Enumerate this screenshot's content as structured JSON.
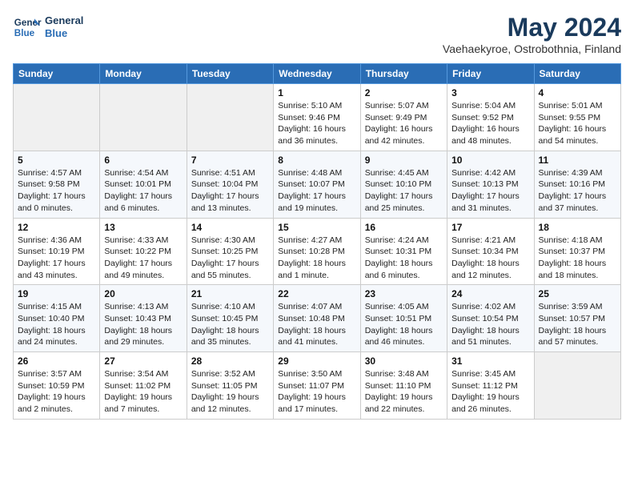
{
  "logo": {
    "line1": "General",
    "line2": "Blue"
  },
  "title": "May 2024",
  "subtitle": "Vaehaekyroe, Ostrobothnia, Finland",
  "headers": [
    "Sunday",
    "Monday",
    "Tuesday",
    "Wednesday",
    "Thursday",
    "Friday",
    "Saturday"
  ],
  "weeks": [
    [
      {
        "day": "",
        "info": ""
      },
      {
        "day": "",
        "info": ""
      },
      {
        "day": "",
        "info": ""
      },
      {
        "day": "1",
        "info": "Sunrise: 5:10 AM\nSunset: 9:46 PM\nDaylight: 16 hours\nand 36 minutes."
      },
      {
        "day": "2",
        "info": "Sunrise: 5:07 AM\nSunset: 9:49 PM\nDaylight: 16 hours\nand 42 minutes."
      },
      {
        "day": "3",
        "info": "Sunrise: 5:04 AM\nSunset: 9:52 PM\nDaylight: 16 hours\nand 48 minutes."
      },
      {
        "day": "4",
        "info": "Sunrise: 5:01 AM\nSunset: 9:55 PM\nDaylight: 16 hours\nand 54 minutes."
      }
    ],
    [
      {
        "day": "5",
        "info": "Sunrise: 4:57 AM\nSunset: 9:58 PM\nDaylight: 17 hours\nand 0 minutes."
      },
      {
        "day": "6",
        "info": "Sunrise: 4:54 AM\nSunset: 10:01 PM\nDaylight: 17 hours\nand 6 minutes."
      },
      {
        "day": "7",
        "info": "Sunrise: 4:51 AM\nSunset: 10:04 PM\nDaylight: 17 hours\nand 13 minutes."
      },
      {
        "day": "8",
        "info": "Sunrise: 4:48 AM\nSunset: 10:07 PM\nDaylight: 17 hours\nand 19 minutes."
      },
      {
        "day": "9",
        "info": "Sunrise: 4:45 AM\nSunset: 10:10 PM\nDaylight: 17 hours\nand 25 minutes."
      },
      {
        "day": "10",
        "info": "Sunrise: 4:42 AM\nSunset: 10:13 PM\nDaylight: 17 hours\nand 31 minutes."
      },
      {
        "day": "11",
        "info": "Sunrise: 4:39 AM\nSunset: 10:16 PM\nDaylight: 17 hours\nand 37 minutes."
      }
    ],
    [
      {
        "day": "12",
        "info": "Sunrise: 4:36 AM\nSunset: 10:19 PM\nDaylight: 17 hours\nand 43 minutes."
      },
      {
        "day": "13",
        "info": "Sunrise: 4:33 AM\nSunset: 10:22 PM\nDaylight: 17 hours\nand 49 minutes."
      },
      {
        "day": "14",
        "info": "Sunrise: 4:30 AM\nSunset: 10:25 PM\nDaylight: 17 hours\nand 55 minutes."
      },
      {
        "day": "15",
        "info": "Sunrise: 4:27 AM\nSunset: 10:28 PM\nDaylight: 18 hours\nand 1 minute."
      },
      {
        "day": "16",
        "info": "Sunrise: 4:24 AM\nSunset: 10:31 PM\nDaylight: 18 hours\nand 6 minutes."
      },
      {
        "day": "17",
        "info": "Sunrise: 4:21 AM\nSunset: 10:34 PM\nDaylight: 18 hours\nand 12 minutes."
      },
      {
        "day": "18",
        "info": "Sunrise: 4:18 AM\nSunset: 10:37 PM\nDaylight: 18 hours\nand 18 minutes."
      }
    ],
    [
      {
        "day": "19",
        "info": "Sunrise: 4:15 AM\nSunset: 10:40 PM\nDaylight: 18 hours\nand 24 minutes."
      },
      {
        "day": "20",
        "info": "Sunrise: 4:13 AM\nSunset: 10:43 PM\nDaylight: 18 hours\nand 29 minutes."
      },
      {
        "day": "21",
        "info": "Sunrise: 4:10 AM\nSunset: 10:45 PM\nDaylight: 18 hours\nand 35 minutes."
      },
      {
        "day": "22",
        "info": "Sunrise: 4:07 AM\nSunset: 10:48 PM\nDaylight: 18 hours\nand 41 minutes."
      },
      {
        "day": "23",
        "info": "Sunrise: 4:05 AM\nSunset: 10:51 PM\nDaylight: 18 hours\nand 46 minutes."
      },
      {
        "day": "24",
        "info": "Sunrise: 4:02 AM\nSunset: 10:54 PM\nDaylight: 18 hours\nand 51 minutes."
      },
      {
        "day": "25",
        "info": "Sunrise: 3:59 AM\nSunset: 10:57 PM\nDaylight: 18 hours\nand 57 minutes."
      }
    ],
    [
      {
        "day": "26",
        "info": "Sunrise: 3:57 AM\nSunset: 10:59 PM\nDaylight: 19 hours\nand 2 minutes."
      },
      {
        "day": "27",
        "info": "Sunrise: 3:54 AM\nSunset: 11:02 PM\nDaylight: 19 hours\nand 7 minutes."
      },
      {
        "day": "28",
        "info": "Sunrise: 3:52 AM\nSunset: 11:05 PM\nDaylight: 19 hours\nand 12 minutes."
      },
      {
        "day": "29",
        "info": "Sunrise: 3:50 AM\nSunset: 11:07 PM\nDaylight: 19 hours\nand 17 minutes."
      },
      {
        "day": "30",
        "info": "Sunrise: 3:48 AM\nSunset: 11:10 PM\nDaylight: 19 hours\nand 22 minutes."
      },
      {
        "day": "31",
        "info": "Sunrise: 3:45 AM\nSunset: 11:12 PM\nDaylight: 19 hours\nand 26 minutes."
      },
      {
        "day": "",
        "info": ""
      }
    ]
  ],
  "colors": {
    "header_bg": "#2a6db5",
    "header_text": "#ffffff",
    "title_color": "#1a3a5c",
    "odd_row": "#ffffff",
    "even_row": "#f5f8fc",
    "empty_cell": "#f0f0f0"
  }
}
